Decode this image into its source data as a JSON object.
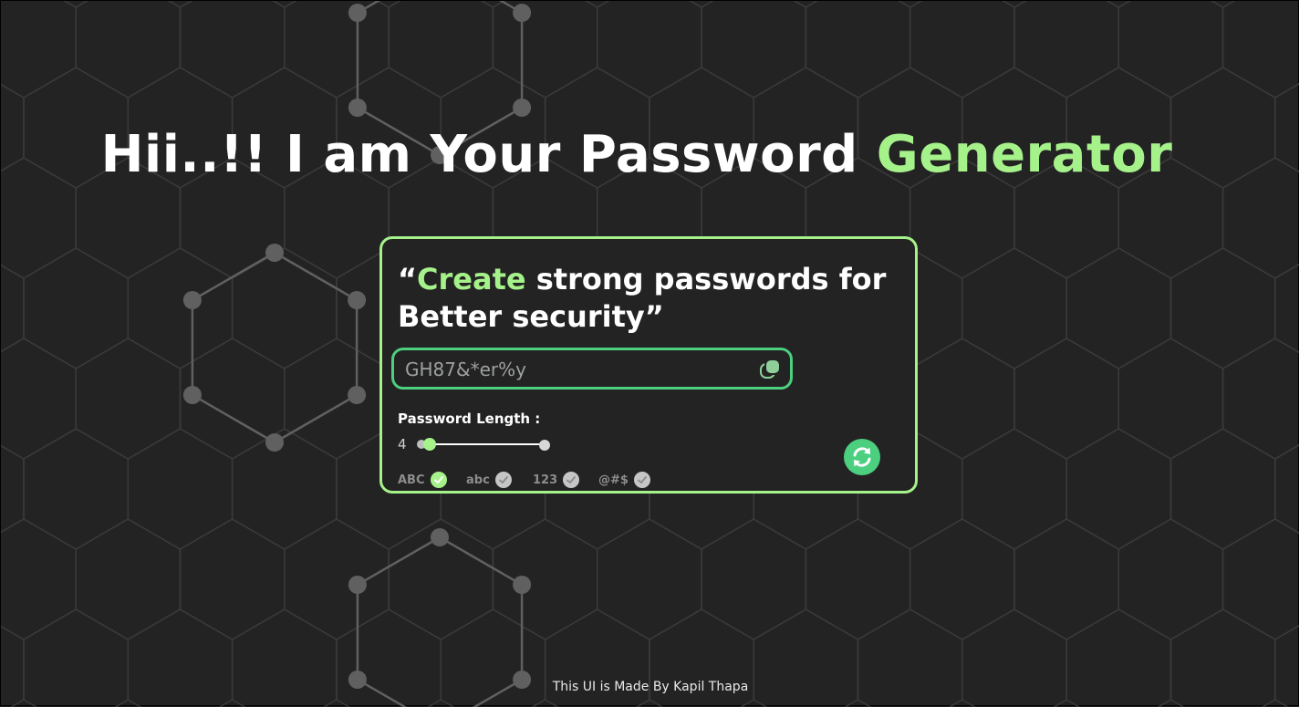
{
  "heading": {
    "prefix": "Hii..!! I am Your Password ",
    "accent": "Generator"
  },
  "card": {
    "quote_open": "“",
    "quote_accent": "Create",
    "quote_rest": " strong passwords for Better security”",
    "password_value": "GH87&*er%y",
    "length_label": "Password Length :",
    "length_value": "4",
    "length_range": {
      "min": 4,
      "max": 20,
      "current": 4
    },
    "options": [
      {
        "label": "ABC",
        "checked": true
      },
      {
        "label": "abc",
        "checked": false
      },
      {
        "label": "123",
        "checked": false
      },
      {
        "label": "@#$",
        "checked": false
      }
    ],
    "icons": {
      "copy": "copy-icon",
      "refresh": "refresh-icon",
      "check": "check-icon"
    }
  },
  "footer": {
    "text": "This UI is Made By Kapil Thapa"
  },
  "colors": {
    "accent": "#a6f28a",
    "secondary": "#4ccf7f",
    "background": "#232323"
  }
}
